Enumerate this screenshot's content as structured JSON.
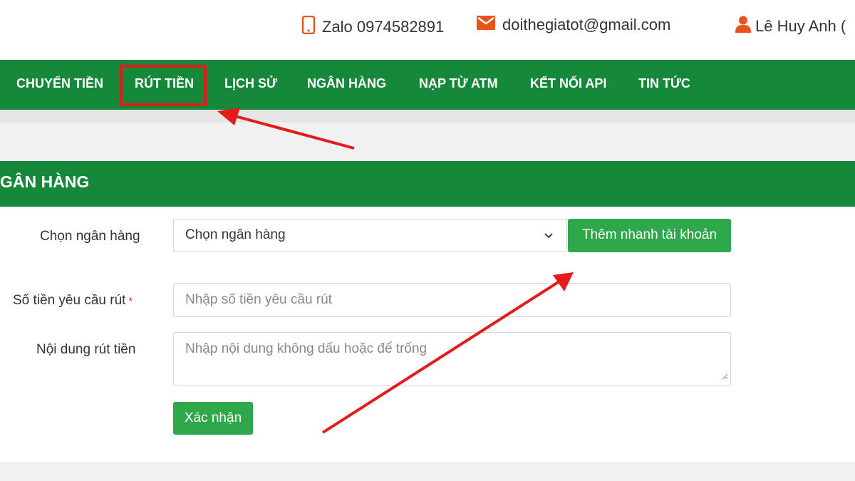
{
  "header": {
    "phone_text": "Zalo 0974582891",
    "email_text": "doithegiatot@gmail.com",
    "user_text": "Lê Huy Anh ("
  },
  "nav": {
    "items": [
      {
        "label": "CHUYỂN TIỀN"
      },
      {
        "label": "RÚT TIỀN"
      },
      {
        "label": "LỊCH SỬ"
      },
      {
        "label": "NGÂN HÀNG"
      },
      {
        "label": "NẠP TỪ ATM"
      },
      {
        "label": "KẾT NỐI API"
      },
      {
        "label": "TIN TỨC"
      }
    ]
  },
  "form": {
    "title": "GÂN HÀNG",
    "bank_label": "Chọn ngân hàng",
    "bank_selected": "Chọn ngân hàng",
    "quick_add_button": "Thêm nhanh tài khoản",
    "amount_label": "Số tiền yêu cầu rút",
    "amount_required_mark": "*",
    "amount_placeholder": "Nhập số tiền yêu cầu rút",
    "content_label": "Nội dung rút tiền",
    "content_placeholder": "Nhập nội dung không dấu hoặc để trống",
    "submit_button": "Xác nhận"
  },
  "colors": {
    "brand_green": "#15883a",
    "button_green": "#2ea84a",
    "icon_orange": "#e8531c",
    "annotation_red": "#e31b1b"
  },
  "icons": [
    "phone-icon",
    "email-icon",
    "user-icon",
    "chevron-down-icon",
    "resize-handle-icon"
  ]
}
